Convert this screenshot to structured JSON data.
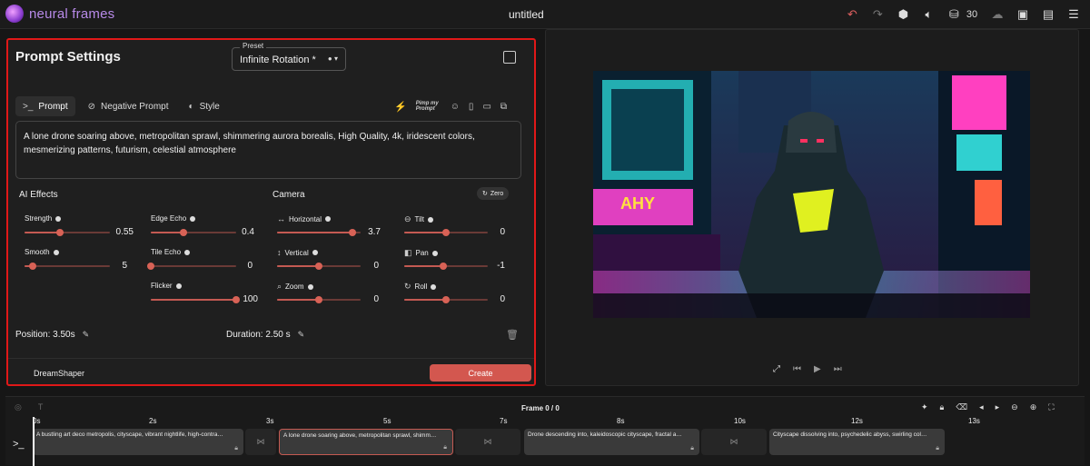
{
  "app": {
    "name": "neural frames",
    "document_title": "untitled",
    "credits": "30"
  },
  "topbar": {
    "icons": [
      "undo-icon",
      "redo-icon",
      "cube-icon",
      "volume-icon",
      "coins-icon",
      "cloud-icon",
      "save-icon",
      "document-icon",
      "menu-icon"
    ]
  },
  "prompt_settings": {
    "title": "Prompt Settings",
    "preset": {
      "label": "Preset",
      "value": "Infinite Rotation *"
    },
    "tabs": [
      {
        "label": "Prompt",
        "active": true
      },
      {
        "label": "Negative Prompt"
      },
      {
        "label": "Style"
      }
    ],
    "tool_logo_text": "Pimp my Prompt",
    "prompt_text": "A lone drone soaring above, metropolitan sprawl, shimmering aurora borealis, High Quality, 4k, iridescent colors, mesmerizing patterns, futurism, celestial atmosphere",
    "ai_effects": {
      "label": "AI Effects",
      "sliders": [
        {
          "name": "Strength",
          "value": "0.55",
          "fraction": 0.42
        },
        {
          "name": "Edge Echo",
          "value": "0.4",
          "fraction": 0.38
        },
        {
          "name": "Smooth",
          "value": "5",
          "fraction": 0.1
        },
        {
          "name": "Tile Echo",
          "value": "0",
          "fraction": 0.0
        },
        {
          "name": "Flicker",
          "value": "100",
          "fraction": 1.0
        }
      ]
    },
    "camera": {
      "label": "Camera",
      "zero_label": "Zero",
      "sliders": [
        {
          "name": "Horizontal",
          "value": "3.7",
          "fraction": 0.9
        },
        {
          "name": "Tilt",
          "value": "0",
          "fraction": 0.5
        },
        {
          "name": "Vertical",
          "value": "0",
          "fraction": 0.5
        },
        {
          "name": "Pan",
          "value": "-1",
          "fraction": 0.47
        },
        {
          "name": "Zoom",
          "value": "0",
          "fraction": 0.5
        },
        {
          "name": "Roll",
          "value": "0",
          "fraction": 0.5
        }
      ]
    },
    "position": "Position:  3.50s",
    "duration": "Duration: 2.50 s",
    "model": "DreamShaper",
    "create_label": "Create"
  },
  "timeline": {
    "frame_label": "Frame 0 / 0",
    "ticks": [
      "0s",
      "2s",
      "3s",
      "5s",
      "7s",
      "8s",
      "10s",
      "12s",
      "13s"
    ],
    "clips": [
      {
        "text": "A bustling art deco metropolis, cityscape, vibrant nightlife, high-contra…"
      },
      {
        "text": "A lone drone soaring above, metropolitan sprawl, shimm…",
        "selected": true
      },
      {
        "text": "Drone descending into, kaleidoscopic cityscape, fractal a…"
      },
      {
        "text": "Cityscape dissolving into, psychedelic abyss, swirling col…"
      }
    ]
  },
  "colors": {
    "accent": "#d3574f",
    "highlight": "#e01818"
  }
}
